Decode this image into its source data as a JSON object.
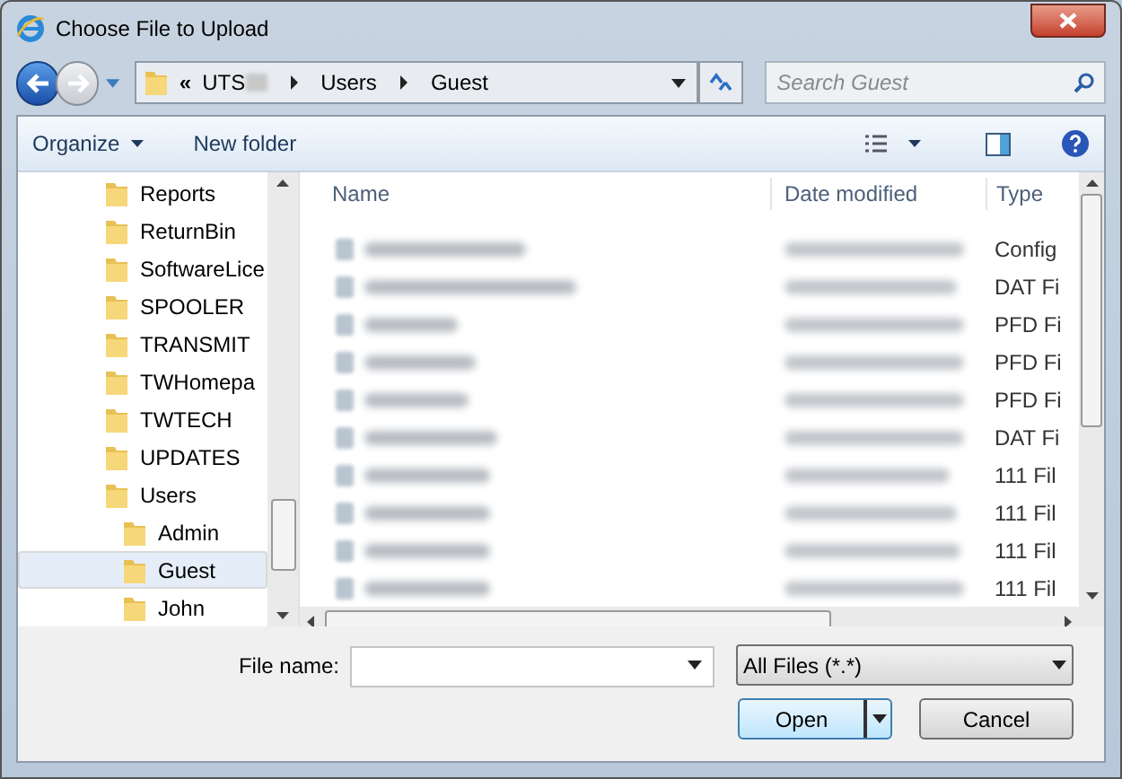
{
  "window": {
    "title": "Choose File to Upload"
  },
  "address_bar": {
    "overflow": "«",
    "crumbs": [
      "UTS",
      "Users",
      "Guest"
    ]
  },
  "search": {
    "placeholder": "Search Guest"
  },
  "toolbar": {
    "organize": "Organize",
    "new_folder": "New folder"
  },
  "tree": [
    {
      "label": "Reports",
      "selected": false
    },
    {
      "label": "ReturnBin",
      "selected": false
    },
    {
      "label": "SoftwareLice",
      "selected": false
    },
    {
      "label": "SPOOLER",
      "selected": false
    },
    {
      "label": "TRANSMIT",
      "selected": false
    },
    {
      "label": "TWHomepa",
      "selected": false
    },
    {
      "label": "TWTECH",
      "selected": false
    },
    {
      "label": "UPDATES",
      "selected": false
    },
    {
      "label": "Users",
      "selected": false,
      "children": [
        {
          "label": "Admin",
          "selected": false
        },
        {
          "label": "Guest",
          "selected": true
        },
        {
          "label": "John",
          "selected": false
        }
      ]
    }
  ],
  "table": {
    "columns": [
      "Name",
      "Date modified",
      "Type"
    ],
    "rows": [
      {
        "type": "Config"
      },
      {
        "type": "DAT Fi"
      },
      {
        "type": "PFD Fi"
      },
      {
        "type": "PFD Fi"
      },
      {
        "type": "PFD Fi"
      },
      {
        "type": "DAT Fi"
      },
      {
        "type": "111 Fil"
      },
      {
        "type": "111 Fil"
      },
      {
        "type": "111 Fil"
      },
      {
        "type": "111 Fil"
      }
    ]
  },
  "file_name": {
    "label": "File name:"
  },
  "file_type": {
    "value": "All Files (*.*)"
  },
  "buttons": {
    "open": "Open",
    "cancel": "Cancel"
  }
}
